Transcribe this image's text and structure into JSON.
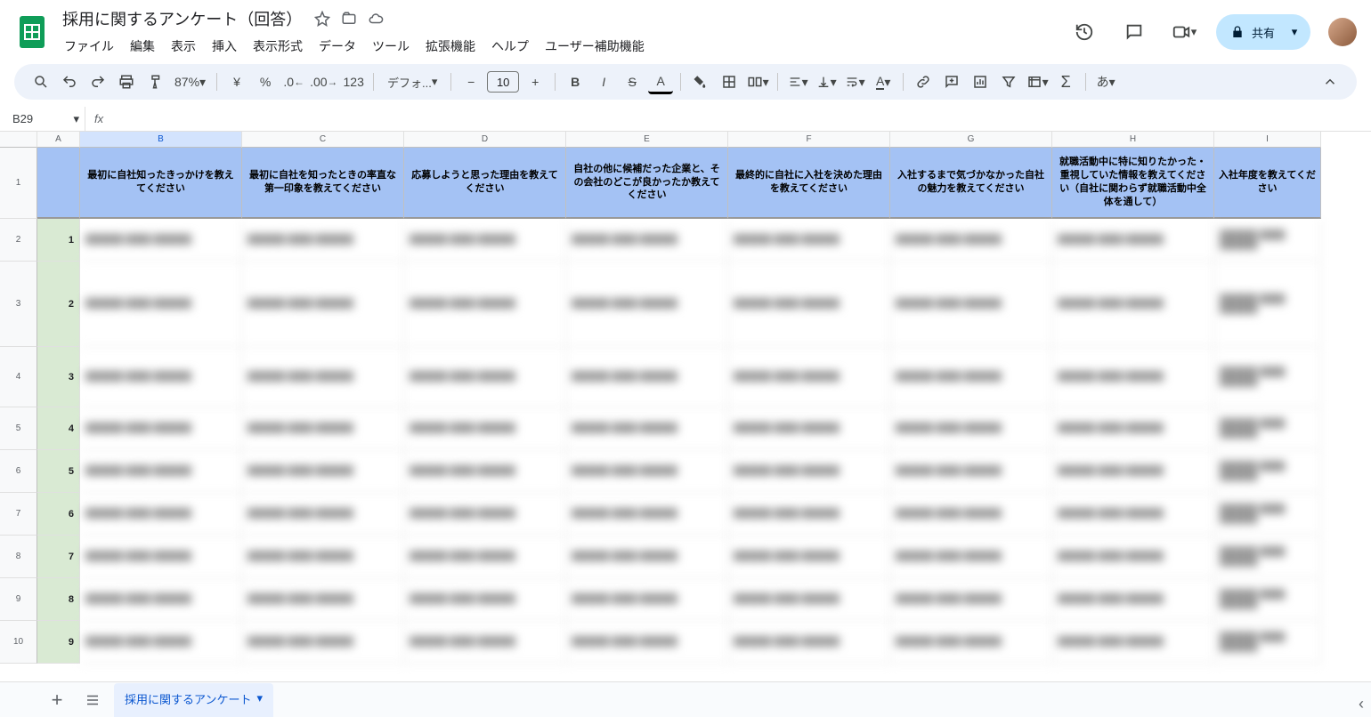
{
  "doc": {
    "title": "採用に関するアンケート（回答）"
  },
  "menubar": [
    "ファイル",
    "編集",
    "表示",
    "挿入",
    "表示形式",
    "データ",
    "ツール",
    "拡張機能",
    "ヘルプ",
    "ユーザー補助機能"
  ],
  "share_label": "共有",
  "toolbar": {
    "zoom": "87%",
    "font": "デフォ...",
    "font_size": "10",
    "locale": "あ"
  },
  "name_box": "B29",
  "columns": [
    "A",
    "B",
    "C",
    "D",
    "E",
    "F",
    "G",
    "H",
    "I"
  ],
  "selected_col": "B",
  "headers": [
    "",
    "最初に自社知ったきっかけを教えてください",
    "最初に自社を知ったときの率直な第一印象を教えてください",
    "応募しようと思った理由を教えてください",
    "自社の他に候補だった企業と、その会社のどこが良かったか教えてください",
    "最終的に自社に入社を決めた理由を教えてください",
    "入社するまで気づかなかった自社の魅力を教えてください",
    "就職活動中に特に知りたかった・重視していた情報を教えてください（自社に関わらず就職活動中全体を通して）",
    "入社年度を教えてください"
  ],
  "row_numbers": [
    "1",
    "2",
    "3",
    "4",
    "5",
    "6",
    "7",
    "8",
    "9",
    "10"
  ],
  "data_ids": [
    "1",
    "2",
    "3",
    "4",
    "5",
    "6",
    "7",
    "8",
    "9"
  ],
  "row_heights": [
    "row-norm",
    "row-tall",
    "row-med",
    "row-norm",
    "row-norm",
    "row-norm",
    "row-norm",
    "row-norm",
    "row-norm"
  ],
  "sheet_tab": "採用に関するアンケート"
}
